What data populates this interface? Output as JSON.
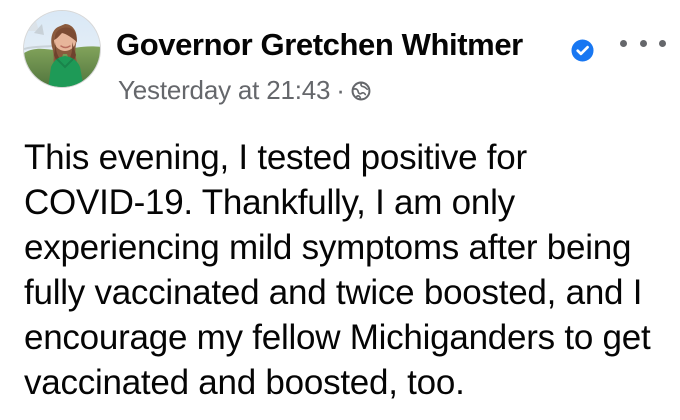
{
  "post": {
    "author": {
      "name": "Governor Gretchen Whitmer",
      "verified_icon": "verified-badge-icon",
      "avatar_icon": "profile-photo"
    },
    "meta": {
      "timestamp": "Yesterday at 21:43",
      "separator": "·",
      "audience_icon": "globe-icon"
    },
    "menu": {
      "icon": "more-options-icon"
    },
    "text": "This evening, I tested positive for\nCOVID-19. Thankfully, I am only\nexperiencing mild symptoms after being\nfully vaccinated and twice boosted, and I\nencourage my fellow Michiganders to get\nvaccinated and boosted, too."
  },
  "colors": {
    "text": "#050505",
    "secondary_text": "#65676b",
    "verified_blue": "#1877f2",
    "background": "#ffffff"
  }
}
